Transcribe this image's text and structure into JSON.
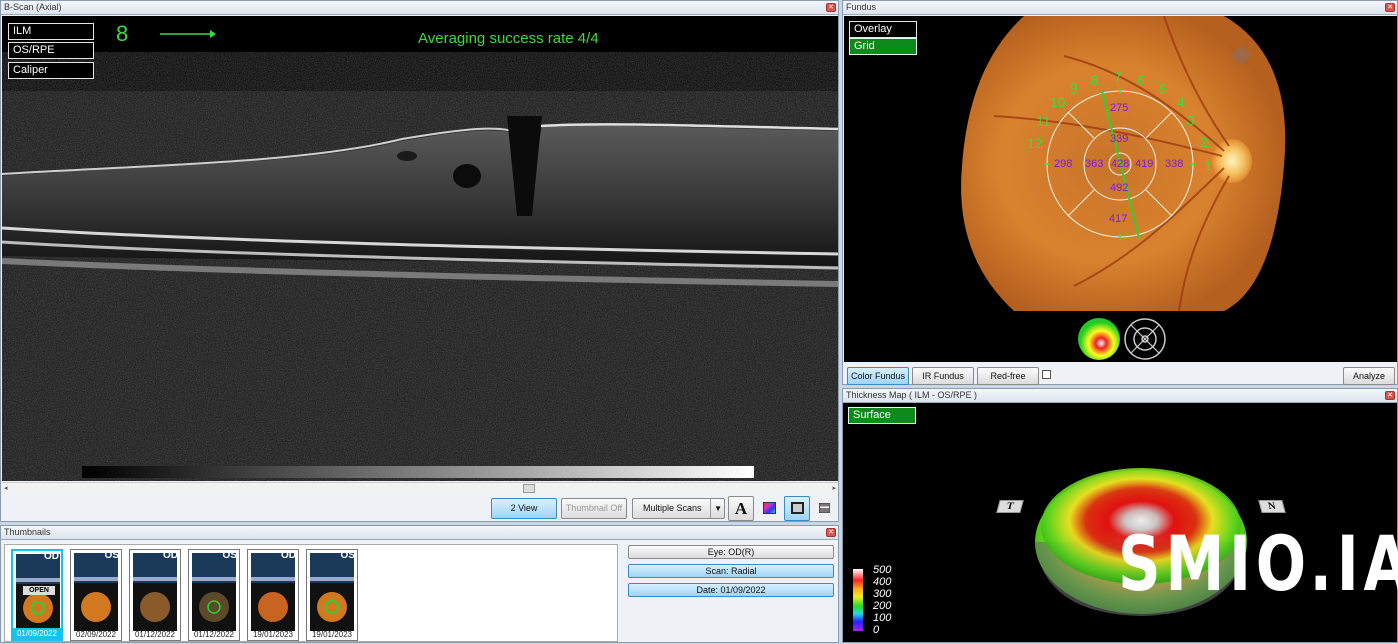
{
  "bscan": {
    "title": "B-Scan (Axial)",
    "layers": [
      "ILM",
      "OS/RPE",
      "Caliper"
    ],
    "scan_number": "8",
    "averaging": "Averaging success rate  4/4",
    "toolbar": {
      "two_view": "2 View",
      "thumbnail_off": "Thumbnail Off",
      "multiple_scans": "Multiple Scans",
      "text_tool": "A"
    }
  },
  "fundus": {
    "title": "Fundus",
    "overlay_label": "Overlay",
    "grid_label": "Grid",
    "clock_numbers": [
      "1",
      "2",
      "3",
      "4",
      "5",
      "6",
      "7",
      "8",
      "9",
      "10",
      "11",
      "12"
    ],
    "thickness_values": {
      "outer_top": "275",
      "inner_top": "339",
      "outer_left": "298",
      "inner_left": "363",
      "center": "428",
      "inner_right": "419",
      "outer_right": "338",
      "inner_bottom": "492",
      "outer_bottom": "417"
    },
    "buttons": {
      "color_fundus": "Color Fundus",
      "ir_fundus": "IR Fundus",
      "red_free": "Red-free",
      "analyze": "Analyze"
    }
  },
  "thickness_map": {
    "title": "Thickness Map   ( ILM - OS/RPE )",
    "surface_label": "Surface",
    "side_left": "T",
    "side_right": "N",
    "scale": [
      "500",
      "400",
      "300",
      "200",
      "100",
      "0"
    ],
    "watermark": "SMIO.IA"
  },
  "thumbnails": {
    "title": "Thumbnails",
    "items": [
      {
        "eye": "OD",
        "date": "01/09/2022",
        "badge": "OPEN"
      },
      {
        "eye": "OS",
        "date": "02/09/2022",
        "badge": ""
      },
      {
        "eye": "OD",
        "date": "01/12/2022",
        "badge": ""
      },
      {
        "eye": "OS",
        "date": "01/12/2022",
        "badge": ""
      },
      {
        "eye": "OD",
        "date": "19/01/2023",
        "badge": ""
      },
      {
        "eye": "OS",
        "date": "19/01/2023",
        "badge": ""
      }
    ],
    "info": {
      "eye": "Eye: OD(R)",
      "scan": "Scan: Radial",
      "date": "Date: 01/09/2022"
    }
  },
  "colors": {
    "accent_green": "#3cdc3c",
    "selection_cyan": "#19c3e6",
    "purple_label": "#7a1fd6"
  }
}
